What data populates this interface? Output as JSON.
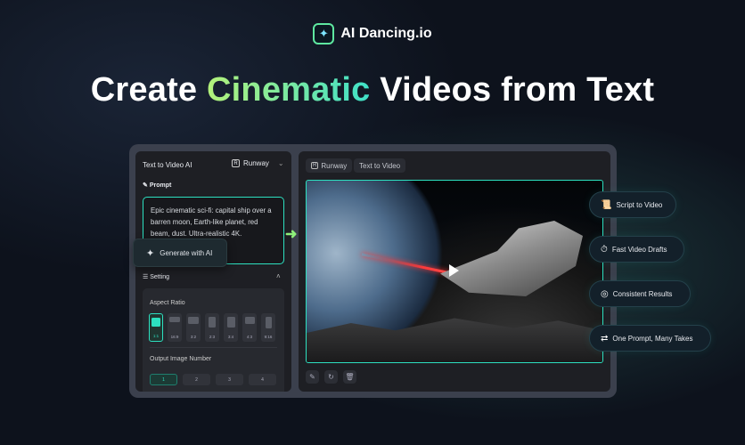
{
  "brand": {
    "name": "AI Dancing.io"
  },
  "headline": {
    "before": "Create ",
    "highlight": "Cinematic",
    "after": " Videos from Text"
  },
  "left_panel": {
    "title": "Text to Video AI",
    "model": "Runway",
    "prompt_label": "Prompt",
    "prompt_text": "Epic cinematic sci-fi: capital ship over a barren moon, Earth-like planet, red beam, dust. Ultra-realistic 4K.",
    "generate_label": "Generate with AI",
    "setting_label": "Setting",
    "aspect_ratio_label": "Aspect Ratio",
    "ratios": [
      "1:1",
      "16:9",
      "3:2",
      "2:3",
      "3:4",
      "4:3",
      "9:16"
    ],
    "selected_ratio": "1:1",
    "output_number_label": "Output Image Number",
    "numbers": [
      "1",
      "2",
      "3",
      "4"
    ],
    "selected_number": "1"
  },
  "right_panel": {
    "tags": [
      "Runway",
      "Text to Video"
    ]
  },
  "features": [
    "Script to Video",
    "Fast Video Drafts",
    "Consistent Results",
    "One Prompt, Many Takes"
  ],
  "colors": {
    "accent": "#2de0c0",
    "green": "#b4f27a"
  }
}
